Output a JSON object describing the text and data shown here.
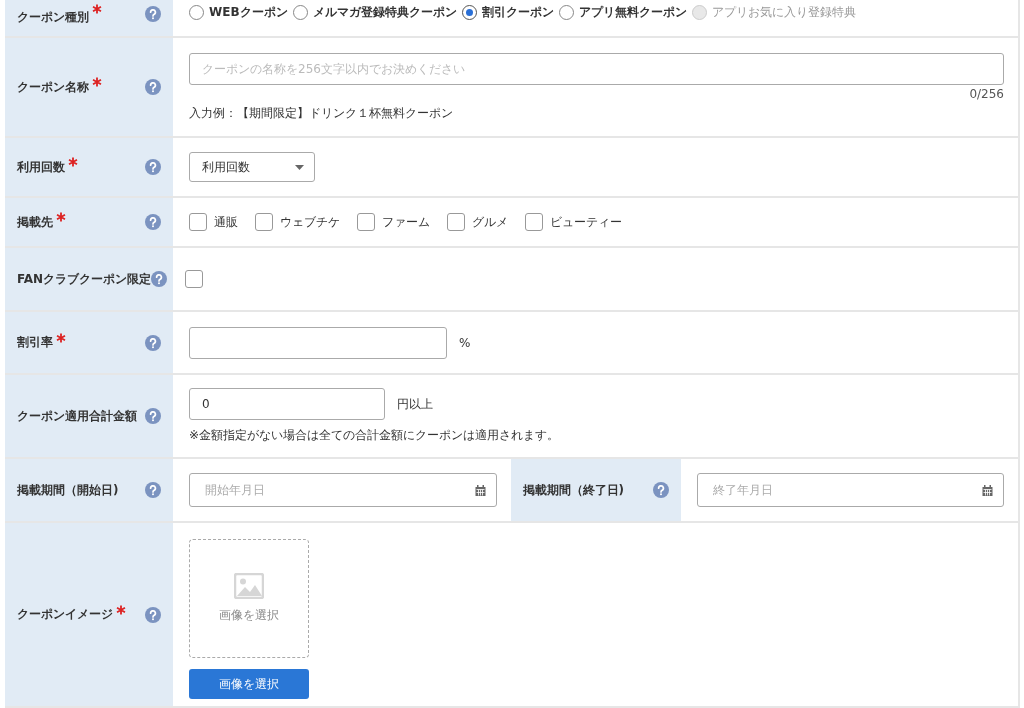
{
  "fields": [
    {
      "kind": "radio",
      "label": "クーポン種別",
      "required": true,
      "options": [
        {
          "label": "WEBクーポン",
          "selected": false,
          "disabled": false
        },
        {
          "label": "メルマガ登録特典クーポン",
          "selected": false,
          "disabled": false
        },
        {
          "label": "割引クーポン",
          "selected": true,
          "disabled": false
        },
        {
          "label": "アプリ無料クーポン",
          "selected": false,
          "disabled": false
        },
        {
          "label": "アプリお気に入り登録特典",
          "selected": false,
          "disabled": true
        }
      ]
    },
    {
      "kind": "text",
      "label": "クーポン名称",
      "required": true,
      "placeholder": "クーポンの名称を256文字以内でお決めください",
      "counter": "0/256",
      "hint": "入力例：【期間限定】ドリンク１杯無料クーポン"
    },
    {
      "kind": "select",
      "label": "利用回数",
      "required": true,
      "value": "利用回数"
    },
    {
      "kind": "checkboxes",
      "label": "掲載先",
      "required": true,
      "options": [
        {
          "label": "通販",
          "checked": false
        },
        {
          "label": "ウェブチケ",
          "checked": false
        },
        {
          "label": "ファーム",
          "checked": false
        },
        {
          "label": "グルメ",
          "checked": false
        },
        {
          "label": "ビューティー",
          "checked": false
        }
      ]
    },
    {
      "kind": "checkbox",
      "label": "FANクラブクーポン限定",
      "required": false,
      "checked": false
    },
    {
      "kind": "percent",
      "label": "割引率",
      "required": true,
      "unit": "%"
    },
    {
      "kind": "amount",
      "label": "クーポン適用合計金額",
      "required": false,
      "value": "0",
      "unit": "円以上",
      "hint": "※金額指定がない場合は全ての合計金額にクーポンは適用されます。"
    },
    {
      "kind": "daterange",
      "label": "掲載期間（開始日)",
      "required": false,
      "placeholder": "開始年月日",
      "end_label": "掲載期間（終了日)",
      "end_required": false,
      "end_placeholder": "終了年月日"
    },
    {
      "kind": "image",
      "label": "クーポンイメージ",
      "required": true,
      "drop_text": "画像を選択",
      "button": "画像を選択"
    }
  ]
}
